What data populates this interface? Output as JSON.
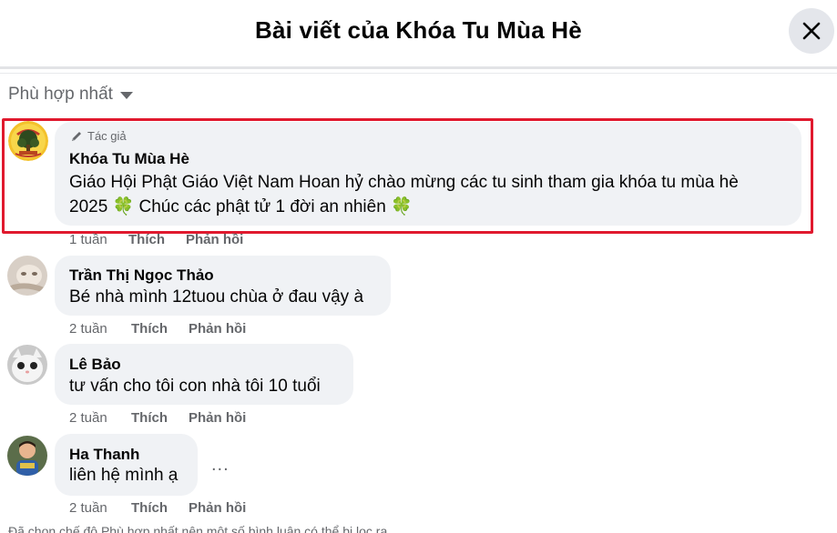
{
  "dialog": {
    "title": "Bài viết của Khóa Tu Mùa Hè",
    "close_icon": "close-icon"
  },
  "sort": {
    "label": "Phù hợp nhất",
    "icon": "caret-down-icon"
  },
  "comments": [
    {
      "author_tag": "Tác giả",
      "author_tag_icon": "pencil-icon",
      "name": "Khóa Tu Mùa Hè",
      "text_line1": "Giáo Hội Phật Giáo Việt Nam Hoan hỷ chào mừng các tu sinh tham gia khóa tu mùa hè",
      "text_line2": "2025 🍀 Chúc các phật tử 1 đời an nhiên 🍀",
      "time": "1 tuần",
      "like": "Thích",
      "reply": "Phản hồi",
      "highlighted": true,
      "highlight_color": "#e0192e"
    },
    {
      "name": "Trần Thị Ngọc Thảo",
      "text": "Bé nhà mình 12tuou chùa ở đau vậy à",
      "time": "2 tuần",
      "like": "Thích",
      "reply": "Phản hồi"
    },
    {
      "name": "Lê Bảo",
      "text": "tư vấn cho tôi con nhà tôi 10 tuổi",
      "time": "2 tuần",
      "like": "Thích",
      "reply": "Phản hồi"
    },
    {
      "name": "Ha Thanh",
      "text": "liên hệ mình ạ",
      "time": "2 tuần",
      "like": "Thích",
      "reply": "Phản hồi",
      "more": "..."
    }
  ],
  "footer": {
    "note": "Đã chọn chế độ Phù hợp nhất nên một số bình luận có thể bị lọc ra."
  },
  "colors": {
    "bubble": "#f0f2f5",
    "secondary_text": "#65676b",
    "close_button_bg": "#e4e6eb"
  }
}
